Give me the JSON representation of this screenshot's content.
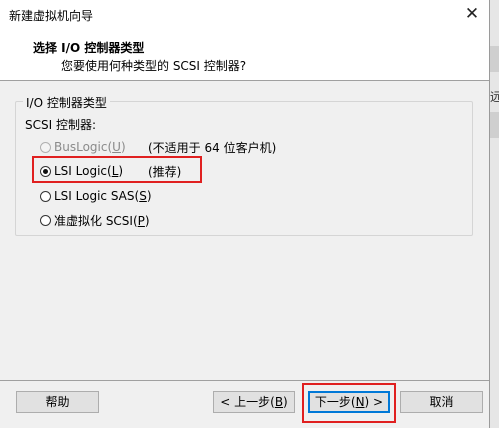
{
  "window": {
    "title": "新建虚拟机向导",
    "close_glyph": "✕"
  },
  "header": {
    "heading": "选择 I/O 控制器类型",
    "subheading": "您要使用何种类型的 SCSI 控制器?"
  },
  "group": {
    "legend": "I/O 控制器类型",
    "scsi_label": "SCSI 控制器:"
  },
  "options": [
    {
      "pre": "BusLogic(",
      "key": "U",
      "post": ")",
      "note": "(不适用于 64 位客户机)",
      "selected": false,
      "enabled": false
    },
    {
      "pre": "LSI Logic(",
      "key": "L",
      "post": ")",
      "note": "(推荐)",
      "selected": true,
      "enabled": true
    },
    {
      "pre": "LSI Logic SAS(",
      "key": "S",
      "post": ")",
      "note": "",
      "selected": false,
      "enabled": true
    },
    {
      "pre": "准虚拟化 SCSI(",
      "key": "P",
      "post": ")",
      "note": "",
      "selected": false,
      "enabled": true
    }
  ],
  "buttons": {
    "help": "帮助",
    "back": {
      "pre": "< 上一步(",
      "key": "B",
      "post": ")"
    },
    "next": {
      "pre": "下一步(",
      "key": "N",
      "post": ") >"
    },
    "cancel": "取消"
  },
  "background_window": {
    "visible_char": "远"
  },
  "colors": {
    "highlight": "#e02020",
    "default_button_border": "#0078d7"
  }
}
